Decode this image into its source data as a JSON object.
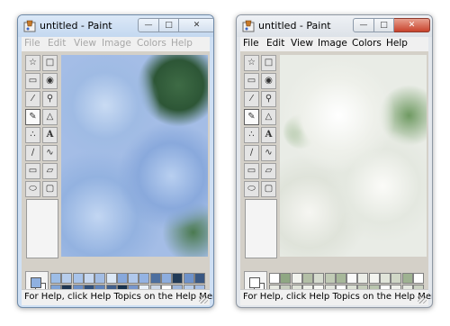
{
  "windows": [
    {
      "id": "blue",
      "title": "untitled - Paint",
      "menu": [
        "File",
        "Edit",
        "View",
        "Image",
        "Colors",
        "Help"
      ],
      "status": "For Help, click Help Topics on the Help Menu.",
      "palette": {
        "foreground": "#8fb0e0",
        "background": "#ffffff",
        "colors": [
          "#9dbde6",
          "#7fa3d6",
          "#b7cdec",
          "#1f3652",
          "#a9c4ea",
          "#6b8fc7",
          "#c7d8f0",
          "#2f4f7a",
          "#a3bde4",
          "#5e82bb",
          "#dce8f6",
          "#405f8c",
          "#87a8dc",
          "#17324f",
          "#b0c8ec",
          "#7796cc",
          "#94b3e3",
          "#eaf1fa",
          "#4d6f9f",
          "#ced9e8",
          "#8dadde",
          "#ffffff",
          "#223b58",
          "#9fb7dc",
          "#6e92ca",
          "#b9cdea",
          "#3a5883",
          "#a6bfe6"
        ]
      }
    },
    {
      "id": "white",
      "title": "untitled - Paint",
      "menu": [
        "File",
        "Edit",
        "View",
        "Image",
        "Colors",
        "Help"
      ],
      "status": "For Help, click Help Topics on the Help Menu.",
      "palette": {
        "foreground": "#ffffff",
        "background": "#ffffff",
        "colors": [
          "#ffffff",
          "#e8eae2",
          "#8fa783",
          "#c9cfc1",
          "#f2f3ee",
          "#dfe3d8",
          "#b3bfa6",
          "#eef0e9",
          "#d6dccf",
          "#f7f8f4",
          "#c1cbb6",
          "#e4e7df",
          "#a7b89a",
          "#ffffff",
          "#fafafa",
          "#dde2d6",
          "#eceee8",
          "#c5cdbb",
          "#f3f4ef",
          "#b9c5ad",
          "#e1e5da",
          "#ffffff",
          "#d0d7c6",
          "#f0f1ec",
          "#9eb291",
          "#e6e9e1",
          "#ffffff",
          "#cbd2c2"
        ]
      }
    }
  ]
}
